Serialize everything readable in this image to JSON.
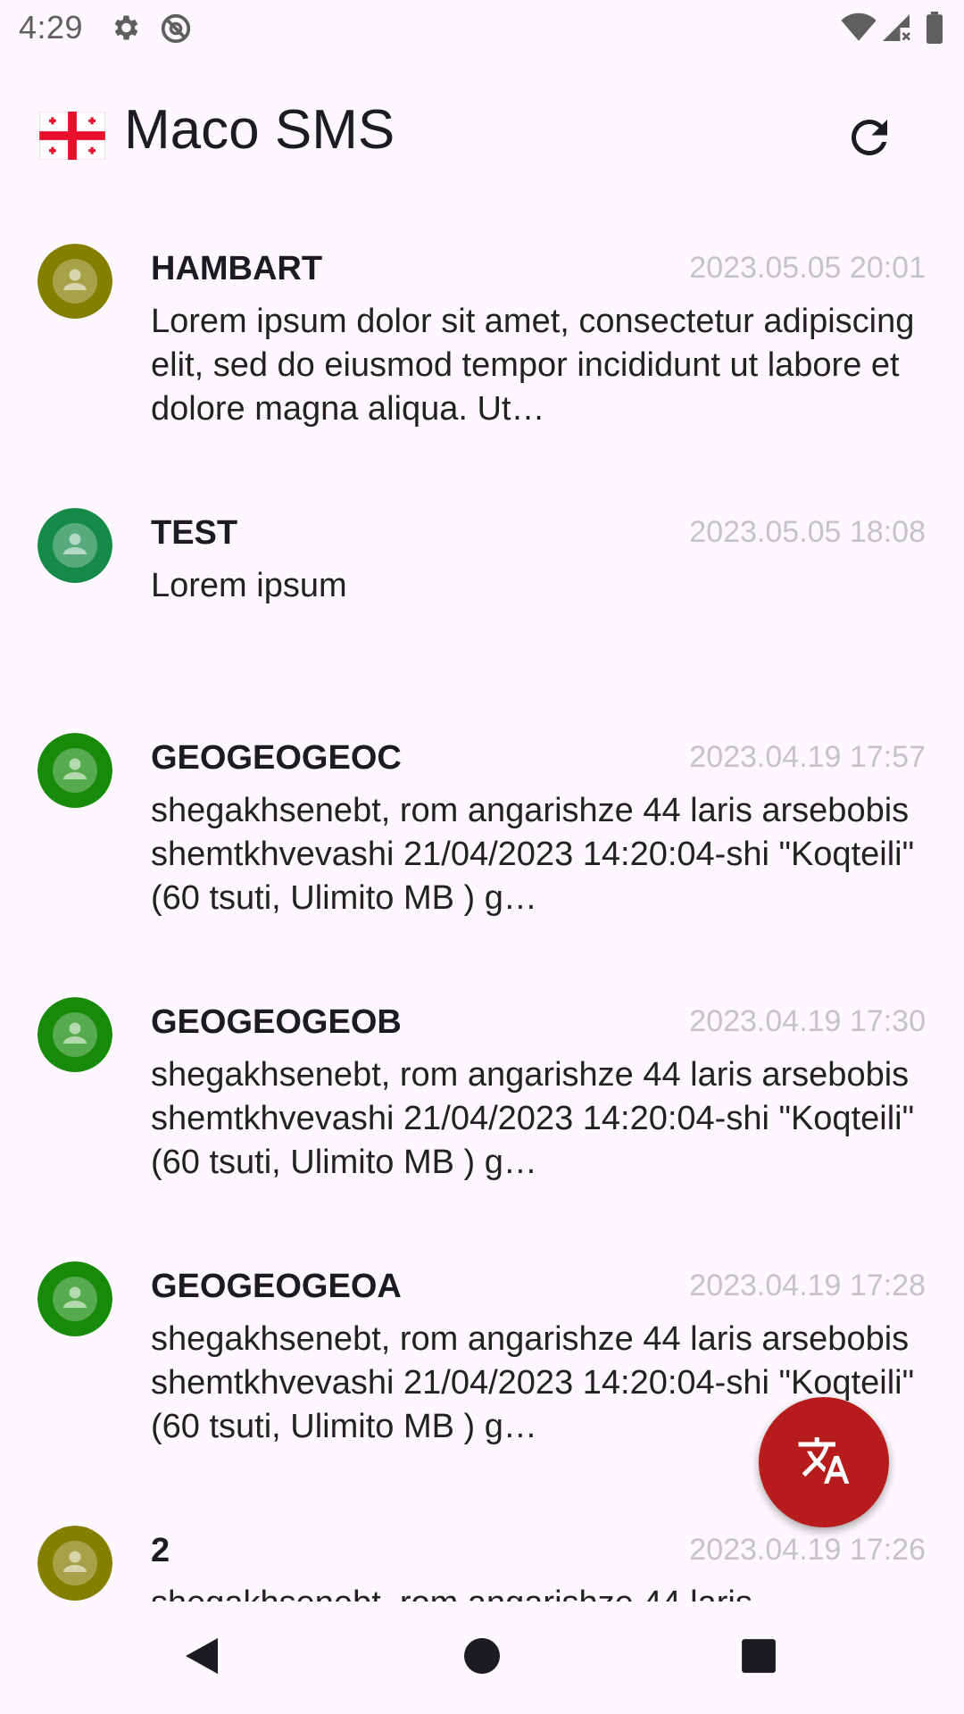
{
  "status_bar": {
    "time": "4:29",
    "icons": [
      "gear-icon",
      "no-sync-icon",
      "wifi-icon",
      "signal-icon",
      "battery-icon"
    ]
  },
  "app_bar": {
    "title": "Maco SMS",
    "flag": "georgia-flag-icon",
    "refresh_icon": "refresh-icon"
  },
  "messages": [
    {
      "sender": "HAMBART",
      "date": "2023.05.05 20:01",
      "body": "Lorem ipsum dolor sit amet, consectetur adipiscing elit, sed do eiusmod tempor incididunt ut labore et dolore magna aliqua. Ut…",
      "avatar_color": "#857f00"
    },
    {
      "sender": "TEST",
      "date": "2023.05.05 18:08",
      "body": "Lorem ipsum",
      "avatar_color": "#168a48"
    },
    {
      "sender": "GEOGEOGEOC",
      "date": "2023.04.19 17:57",
      "body": "shegakhsenebt, rom angarishze 44 laris arsebobis shemtkhvevashi 21/04/2023 14:20:04-shi \"Koqteili\" (60 tsuti, Ulimito MB  ) g…",
      "avatar_color": "#178a0a"
    },
    {
      "sender": "GEOGEOGEOB",
      "date": "2023.04.19 17:30",
      "body": "shegakhsenebt, rom angarishze 44 laris arsebobis shemtkhvevashi 21/04/2023 14:20:04-shi \"Koqteili\" (60 tsuti, Ulimito MB  ) g…",
      "avatar_color": "#178a0a"
    },
    {
      "sender": "GEOGEOGEOA",
      "date": "2023.04.19 17:28",
      "body": "shegakhsenebt, rom angarishze 44 laris arsebobis shemtkhvevashi 21/04/2023 14:20:04-shi \"Koqteili\" (60 tsuti, Ulimito MB  ) g…",
      "avatar_color": "#178a0a"
    },
    {
      "sender": "2",
      "date": "2023.04.19 17:26",
      "body": "shegakhsenebt, rom angarishze 44 laris",
      "avatar_color": "#857f00"
    }
  ],
  "fab": {
    "icon": "translate-icon",
    "color": "#b71c1c"
  },
  "nav_bar": {
    "icons": [
      "back-icon",
      "home-icon",
      "recents-icon"
    ]
  }
}
